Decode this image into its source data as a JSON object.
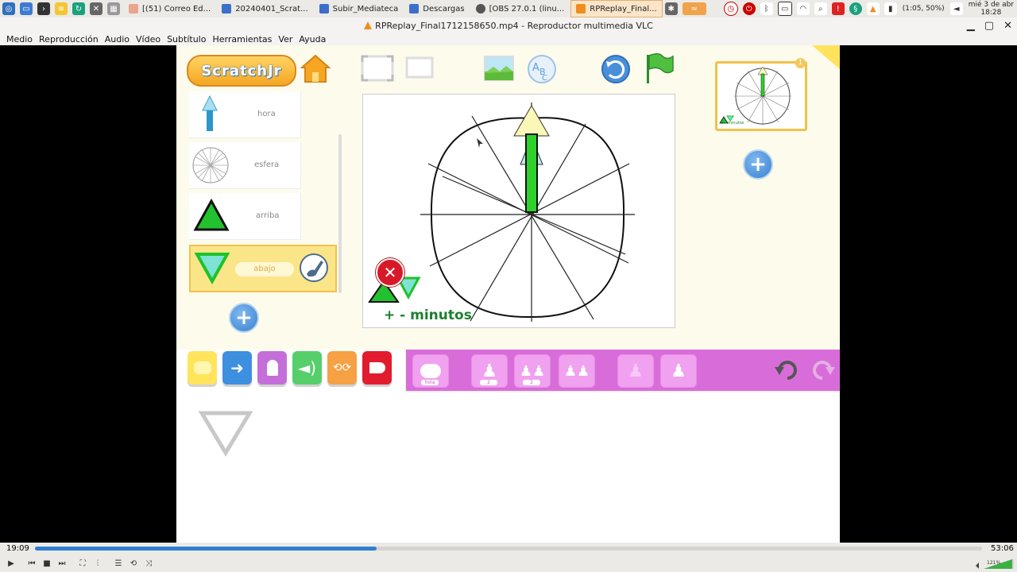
{
  "taskbar": {
    "tasks": [
      {
        "label": "[(51) Correo Ed...",
        "color": "#e9a58f"
      },
      {
        "label": "20240401_Scrat...",
        "color": "#3b6fc9"
      },
      {
        "label": "Subir_Mediateca",
        "color": "#3b6fc9"
      },
      {
        "label": "Descargas",
        "color": "#3b6fc9"
      },
      {
        "label": "[OBS 27.0.1 (linu...",
        "color": "#555555"
      },
      {
        "label": "RPReplay_Final...",
        "color": "#f28c1e"
      }
    ],
    "battery": "(1:05, 50%)",
    "date": "mié 3 de abr",
    "time": "18:28"
  },
  "window": {
    "title": "RPReplay_Final1712158650.mp4 - Reproductor multimedia VLC"
  },
  "menu": [
    "Medio",
    "Reproducción",
    "Audio",
    "Vídeo",
    "Subtítulo",
    "Herramientas",
    "Ver",
    "Ayuda"
  ],
  "scratch": {
    "logo": "ScratchJr",
    "sprites": [
      {
        "name": "hora"
      },
      {
        "name": "esfera"
      },
      {
        "name": "arriba"
      },
      {
        "name": "abajo"
      }
    ],
    "stage_caption": "+ - minutos",
    "thumb_caption": "+ - minutos",
    "thumb_number": "1",
    "block_tags": [
      "hola",
      "2",
      "2"
    ]
  },
  "player": {
    "elapsed": "19:09",
    "total": "53:06",
    "progress_fraction": 0.361,
    "volume_label": "121%"
  },
  "colors": {
    "accent_blue": "#2f7fd3",
    "scratch_yellow": "#fbe589",
    "looks_pink": "#d86dd9",
    "vlc_orange": "#f28c1e"
  }
}
